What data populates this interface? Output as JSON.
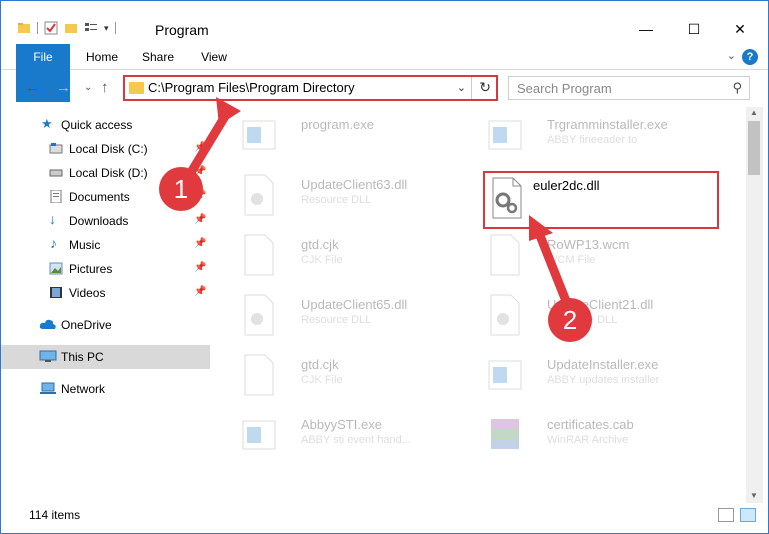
{
  "window": {
    "title": "Program",
    "minimize": "—",
    "maximize": "☐",
    "close": "✕"
  },
  "ribbon": {
    "tabs": [
      "File",
      "Home",
      "Share",
      "View"
    ],
    "help": "?"
  },
  "address": {
    "path": "C:\\Program Files\\Program Directory",
    "dropdown": "⌄",
    "refresh": "↻"
  },
  "search": {
    "placeholder": "Search Program"
  },
  "sidebar": {
    "items": [
      {
        "label": "Quick access",
        "icon": "star-icon"
      },
      {
        "label": "Local Disk (C:)",
        "icon": "drive-icon"
      },
      {
        "label": "Local Disk (D:)",
        "icon": "drive-icon"
      },
      {
        "label": "Documents",
        "icon": "documents-icon"
      },
      {
        "label": "Downloads",
        "icon": "download-icon"
      },
      {
        "label": "Music",
        "icon": "music-icon"
      },
      {
        "label": "Pictures",
        "icon": "pictures-icon"
      },
      {
        "label": "Videos",
        "icon": "videos-icon"
      },
      {
        "label": "OneDrive",
        "icon": "cloud-icon"
      },
      {
        "label": "This PC",
        "icon": "computer-icon"
      },
      {
        "label": "Network",
        "icon": "network-icon"
      }
    ]
  },
  "files": [
    {
      "name": "program.exe",
      "desc": ""
    },
    {
      "name": "Trgramminstaller.exe",
      "desc": "ABBY fineeader to"
    },
    {
      "name": "UpdateClient63.dll",
      "desc": "Resource DLL"
    },
    {
      "name": "euler2dc.dll",
      "desc": ""
    },
    {
      "name": "gtd.cjk",
      "desc": "CJK File"
    },
    {
      "name": "RoWP13.wcm",
      "desc": "WCM File"
    },
    {
      "name": "UpdateClient65.dll",
      "desc": "Resource DLL"
    },
    {
      "name": "UpdateClient21.dll",
      "desc": "Resource DLL"
    },
    {
      "name": "gtd.cjk",
      "desc": "CJK File"
    },
    {
      "name": "UpdateInstaller.exe",
      "desc": "ABBY updates installer"
    },
    {
      "name": "AbbyySTI.exe",
      "desc": "ABBY sti event hand..."
    },
    {
      "name": "certificates.cab",
      "desc": "WinRAR Archive"
    }
  ],
  "status": {
    "count": "114 items"
  },
  "callouts": [
    "1",
    "2"
  ],
  "colors": {
    "accent": "#1979ca",
    "highlight": "#d9363e",
    "selected": "#cce8ff"
  }
}
